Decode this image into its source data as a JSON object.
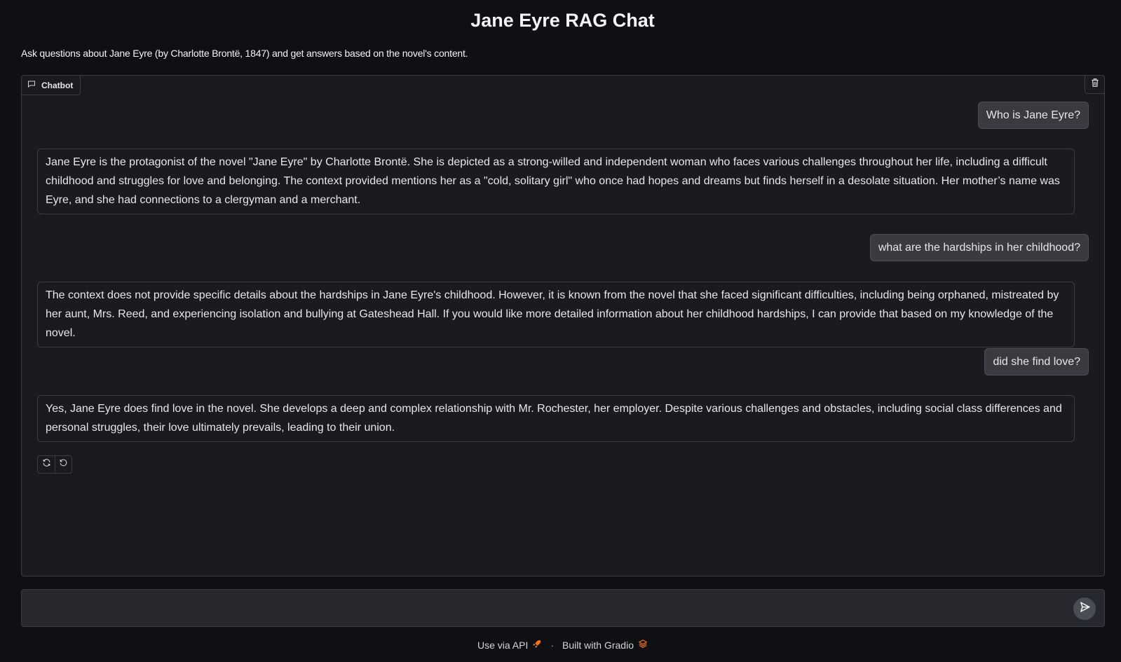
{
  "app": {
    "title": "Jane Eyre RAG Chat",
    "description": "Ask questions about Jane Eyre (by Charlotte Brontë, 1847) and get answers based on the novel's content."
  },
  "chatbot": {
    "label": "Chatbot",
    "label_icon": "chat-icon",
    "clear_icon": "trash-icon",
    "messages": [
      {
        "role": "user",
        "text": "Who is Jane Eyre?"
      },
      {
        "role": "assistant",
        "text": "Jane Eyre is the protagonist of the novel \"Jane Eyre\" by Charlotte Brontë. She is depicted as a strong-willed and independent woman who faces various challenges throughout her life, including a difficult childhood and struggles for love and belonging. The context provided mentions her as a \"cold, solitary girl\" who once had hopes and dreams but finds herself in a desolate situation. Her mother’s name was Eyre, and she had connections to a clergyman and a merchant."
      },
      {
        "role": "user",
        "text": "what are the hardships in her childhood?"
      },
      {
        "role": "assistant",
        "text": "The context does not provide specific details about the hardships in Jane Eyre's childhood. However, it is known from the novel that she faced significant difficulties, including being orphaned, mistreated by her aunt, Mrs. Reed, and experiencing isolation and bullying at Gateshead Hall. If you would like more detailed information about her childhood hardships, I can provide that based on my knowledge of the novel."
      },
      {
        "role": "user",
        "text": "did she find love?"
      },
      {
        "role": "assistant",
        "text": "Yes, Jane Eyre does find love in the novel. She develops a deep and complex relationship with Mr. Rochester, her employer. Despite various challenges and obstacles, including social class differences and personal struggles, their love ultimately prevails, leading to their union."
      }
    ],
    "actions": [
      "retry-icon",
      "undo-icon"
    ]
  },
  "input": {
    "value": "",
    "placeholder": "",
    "send_icon": "send-icon"
  },
  "footer": {
    "api_label": "Use via API",
    "api_icon": "rocket-icon",
    "separator": "·",
    "built_label": "Built with Gradio",
    "built_icon": "gradio-logo-icon"
  }
}
